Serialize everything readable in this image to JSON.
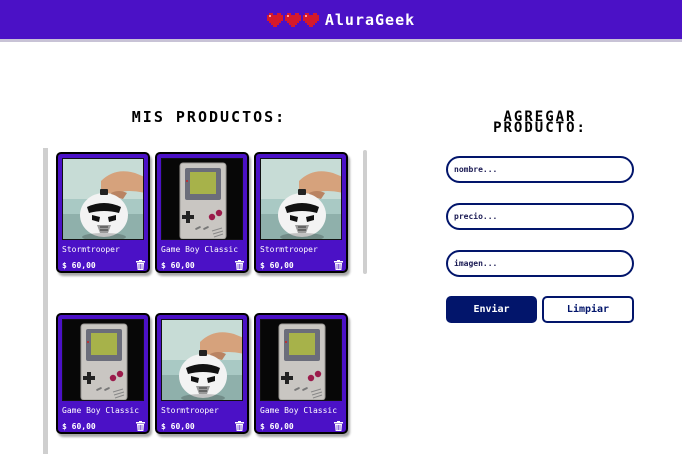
{
  "header": {
    "brand": "AluraGeek",
    "hearts_color": "#d4192b",
    "bar_color": "#4b11c6"
  },
  "products_section": {
    "title": "MIS PRODUCTOS:",
    "items": [
      {
        "name": "Stormtrooper",
        "price": "$ 60,00",
        "image": "stormtrooper-piggy-bank"
      },
      {
        "name": "Game Boy Classic",
        "price": "$ 60,00",
        "image": "game-boy-classic"
      },
      {
        "name": "Stormtrooper",
        "price": "$ 60,00",
        "image": "stormtrooper-piggy-bank"
      },
      {
        "name": "Game Boy Classic",
        "price": "$ 60,00",
        "image": "game-boy-classic"
      },
      {
        "name": "Stormtrooper",
        "price": "$ 60,00",
        "image": "stormtrooper-piggy-bank"
      },
      {
        "name": "Game Boy Classic",
        "price": "$ 60,00",
        "image": "game-boy-classic"
      }
    ]
  },
  "form": {
    "title_line1": "AGREGAR",
    "title_line2": "PRODUCTO:",
    "name_placeholder": "nombre...",
    "price_placeholder": "precio...",
    "image_placeholder": "imagen...",
    "send_label": "Enviar",
    "clear_label": "Limpiar"
  },
  "colors": {
    "accent": "#4b11c6",
    "navy": "#02156b"
  }
}
